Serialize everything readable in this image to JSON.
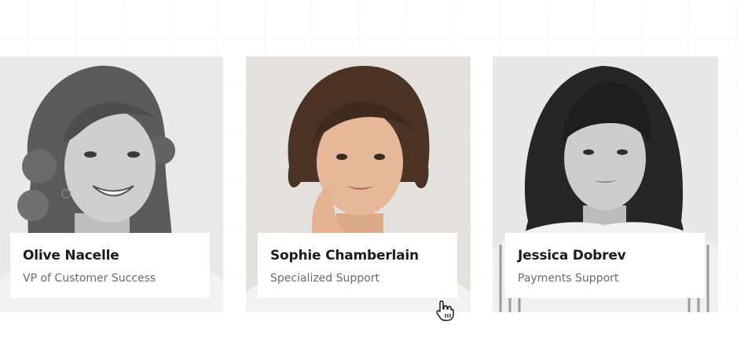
{
  "team": [
    {
      "name": "Olive Nacelle",
      "role": "VP of Customer Success"
    },
    {
      "name": "Sophie Chamberlain",
      "role": "Specialized Support"
    },
    {
      "name": "Jessica Dobrev",
      "role": "Payments Support"
    }
  ],
  "colors": {
    "background": "#ffffff",
    "grid_line": "#ededed",
    "name_text": "#1c1c1c",
    "role_text": "#6b6b6b",
    "card_panel": "#ffffff"
  },
  "cursor": {
    "icon": "hand-pointer-icon"
  }
}
